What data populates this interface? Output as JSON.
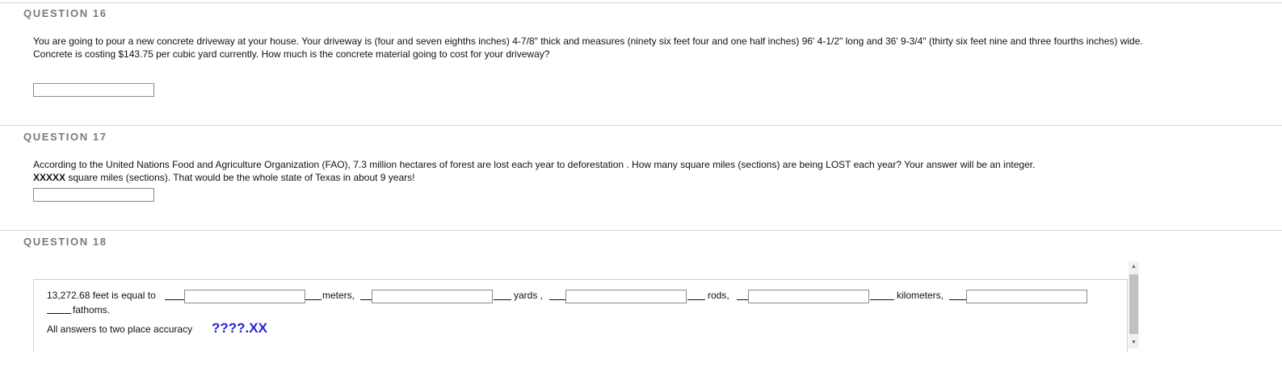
{
  "q16": {
    "heading": "QUESTION 16",
    "text": "You are going to pour a new concrete driveway at your house. Your driveway is (four and seven eighths inches) 4-7/8\" thick and measures (ninety six feet four and one half inches) 96'  4-1/2\" long and 36' 9-3/4\" (thirty six feet nine and three fourths inches) wide. Concrete is costing $143.75 per cubic yard currently. How much is the concrete material going to cost for your driveway?",
    "answer_value": ""
  },
  "q17": {
    "heading": "QUESTION 17",
    "text": "According to the United Nations Food and Agriculture Organization (FAO), 7.3 million hectares of forest are lost each year to deforestation . How many square miles (sections) are being LOST each year? Your answer will be an integer.",
    "bold_part": "XXXXX",
    "text2": " square miles (sections). That would be the whole state of Texas in about 9 years!",
    "answer_value": ""
  },
  "q18": {
    "heading": "QUESTION 18",
    "lead": "13,272.68 feet is equal to",
    "unit_meters": "meters,",
    "unit_yards": "yards ,",
    "unit_rods": "rods,",
    "unit_km": "kilometers,",
    "unit_fathoms": "fathoms.",
    "accuracy_label": "All answers to two place accuracy",
    "accuracy_hint": "????.XX",
    "hint_color": "#2222dd"
  },
  "icons": {
    "scroll_up": "▲",
    "scroll_down": "▼"
  }
}
